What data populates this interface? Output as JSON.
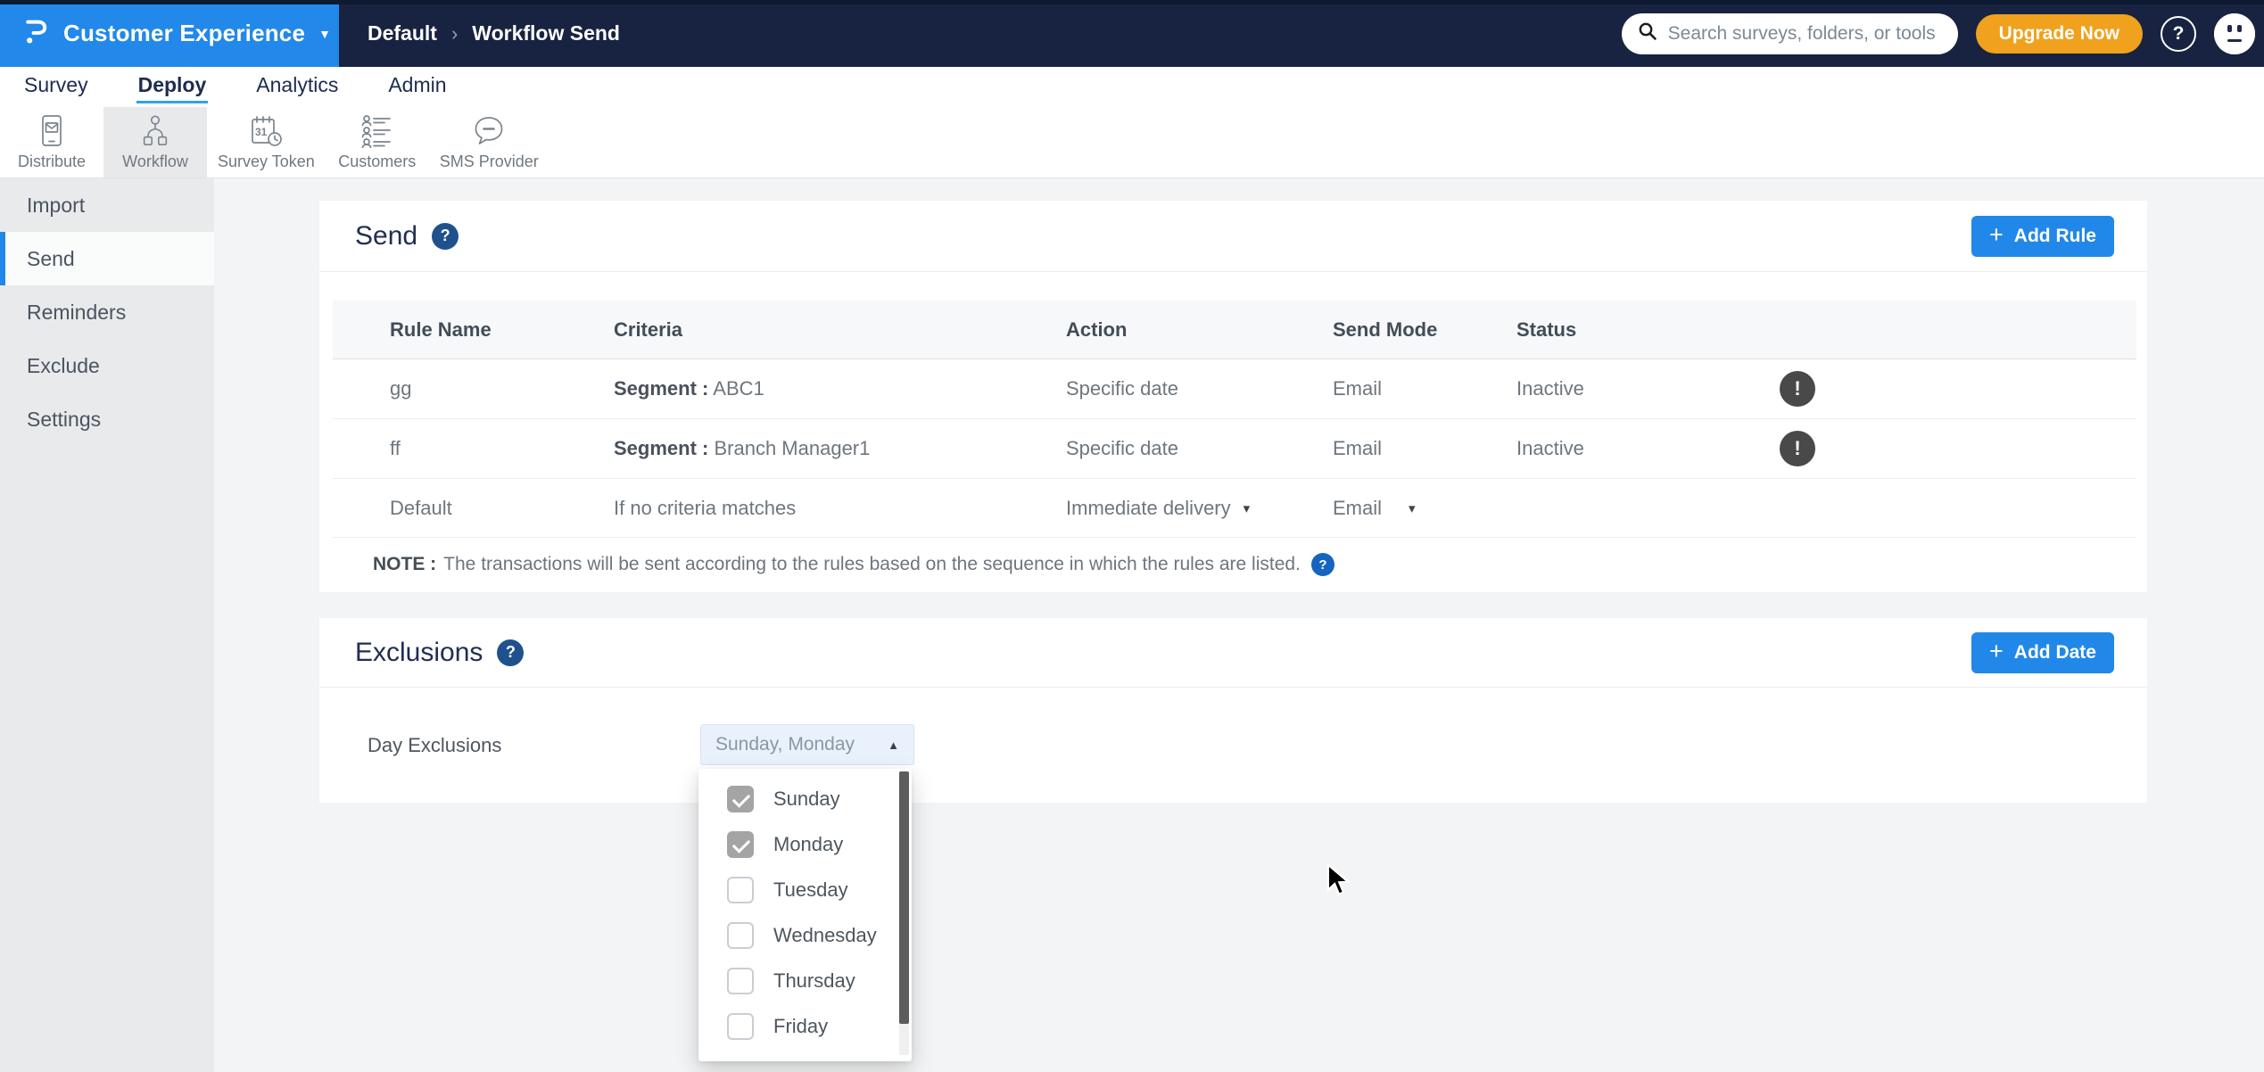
{
  "topbar": {
    "brand_title": "Customer Experience",
    "breadcrumb": [
      "Default",
      "Workflow Send"
    ],
    "search_placeholder": "Search surveys, folders, or tools",
    "upgrade_label": "Upgrade Now"
  },
  "ui": {
    "help_glyph": "?",
    "warning_glyph": "!",
    "plus_glyph": "+",
    "caret_down": "▼",
    "caret_up": "▲",
    "caret_small": "▾",
    "breadcrumb_sep": "›"
  },
  "nav": {
    "tabs": [
      {
        "label": "Survey",
        "active": false
      },
      {
        "label": "Deploy",
        "active": true
      },
      {
        "label": "Analytics",
        "active": false
      },
      {
        "label": "Admin",
        "active": false
      }
    ]
  },
  "toolbar": {
    "items": [
      {
        "label": "Distribute",
        "icon": "distribute-icon",
        "active": false
      },
      {
        "label": "Workflow",
        "icon": "workflow-icon",
        "active": true
      },
      {
        "label": "Survey Token",
        "icon": "survey-token-icon",
        "active": false
      },
      {
        "label": "Customers",
        "icon": "customers-icon",
        "active": false
      },
      {
        "label": "SMS Provider",
        "icon": "sms-provider-icon",
        "active": false
      }
    ]
  },
  "sidebar": {
    "items": [
      {
        "label": "Import",
        "active": false
      },
      {
        "label": "Send",
        "active": true
      },
      {
        "label": "Reminders",
        "active": false
      },
      {
        "label": "Exclude",
        "active": false
      },
      {
        "label": "Settings",
        "active": false
      }
    ]
  },
  "send": {
    "title": "Send",
    "add_label": "Add Rule",
    "table": {
      "headers": [
        "Rule Name",
        "Criteria",
        "Action",
        "Send Mode",
        "Status"
      ],
      "rows": [
        {
          "name": "gg",
          "criteria_label": "Segment :",
          "criteria_value": "ABC1",
          "action": "Specific date",
          "send_mode": "Email",
          "status": "Inactive"
        },
        {
          "name": "ff",
          "criteria_label": "Segment :",
          "criteria_value": "Branch Manager1",
          "action": "Specific date",
          "send_mode": "Email",
          "status": "Inactive"
        }
      ],
      "default_row": {
        "name": "Default",
        "criteria": "If no criteria matches",
        "action": "Immediate delivery",
        "send_mode": "Email"
      }
    },
    "note_label": "NOTE :",
    "note_text": "The transactions will be sent according to the rules based on the sequence in which the rules are listed."
  },
  "exclusions": {
    "title": "Exclusions",
    "add_label": "Add Date",
    "day_label": "Day Exclusions",
    "select_value": "Sunday, Monday",
    "options": [
      {
        "label": "Sunday",
        "checked": true
      },
      {
        "label": "Monday",
        "checked": true
      },
      {
        "label": "Tuesday",
        "checked": false
      },
      {
        "label": "Wednesday",
        "checked": false
      },
      {
        "label": "Thursday",
        "checked": false
      },
      {
        "label": "Friday",
        "checked": false
      }
    ]
  },
  "colors": {
    "brand_blue": "#2288e9",
    "navbar_navy": "#172340",
    "upgrade_orange": "#f0a11d",
    "active_underline": "#2fa3e8",
    "heading_navy": "#202e52",
    "help_badge_navy": "#20518f",
    "note_badge_blue": "#1565c0",
    "warning_charcoal": "#494949",
    "select_bg": "#e9f1fc",
    "checked_gray": "#a4a4a4"
  }
}
